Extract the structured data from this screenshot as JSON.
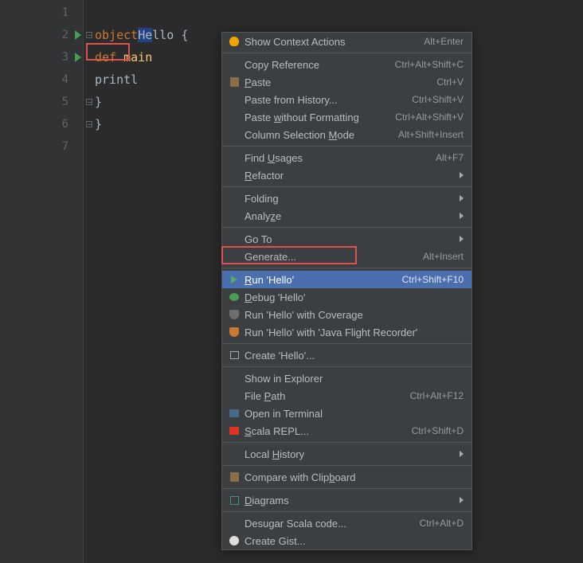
{
  "gutter": {
    "lines": [
      "1",
      "2",
      "3",
      "4",
      "5",
      "6",
      "7"
    ]
  },
  "code": {
    "l2_kw": "object",
    "l2_name": "Hello",
    "l2_open": " {",
    "l3_kw": "def ",
    "l3_fn": "main",
    "l4_txt": "printl",
    "l5_txt": "}",
    "l6_txt": "}"
  },
  "menu": {
    "show_context": "Show Context Actions",
    "show_context_sc": "Alt+Enter",
    "copy_ref": "Copy Reference",
    "copy_ref_sc": "Ctrl+Alt+Shift+C",
    "paste": "Paste",
    "paste_sc": "Ctrl+V",
    "paste_hist": "Paste from History...",
    "paste_hist_sc": "Ctrl+Shift+V",
    "paste_plain": "Paste without Formatting",
    "paste_plain_sc": "Ctrl+Alt+Shift+V",
    "col_sel": "Column Selection Mode",
    "col_sel_sc": "Alt+Shift+Insert",
    "find_usages": "Find Usages",
    "find_usages_sc": "Alt+F7",
    "refactor": "Refactor",
    "folding": "Folding",
    "analyze": "Analyze",
    "goto": "Go To",
    "generate": "Generate...",
    "generate_sc": "Alt+Insert",
    "run": "Run 'Hello'",
    "run_sc": "Ctrl+Shift+F10",
    "debug": "Debug 'Hello'",
    "coverage": "Run 'Hello' with Coverage",
    "jfr": "Run 'Hello' with 'Java Flight Recorder'",
    "create": "Create 'Hello'...",
    "show_explorer": "Show in Explorer",
    "file_path": "File Path",
    "file_path_sc": "Ctrl+Alt+F12",
    "open_term": "Open in Terminal",
    "scala_repl": "Scala REPL...",
    "scala_repl_sc": "Ctrl+Shift+D",
    "local_hist": "Local History",
    "compare_clip": "Compare with Clipboard",
    "diagrams": "Diagrams",
    "desugar": "Desugar Scala code...",
    "desugar_sc": "Ctrl+Alt+D",
    "gist": "Create Gist..."
  }
}
